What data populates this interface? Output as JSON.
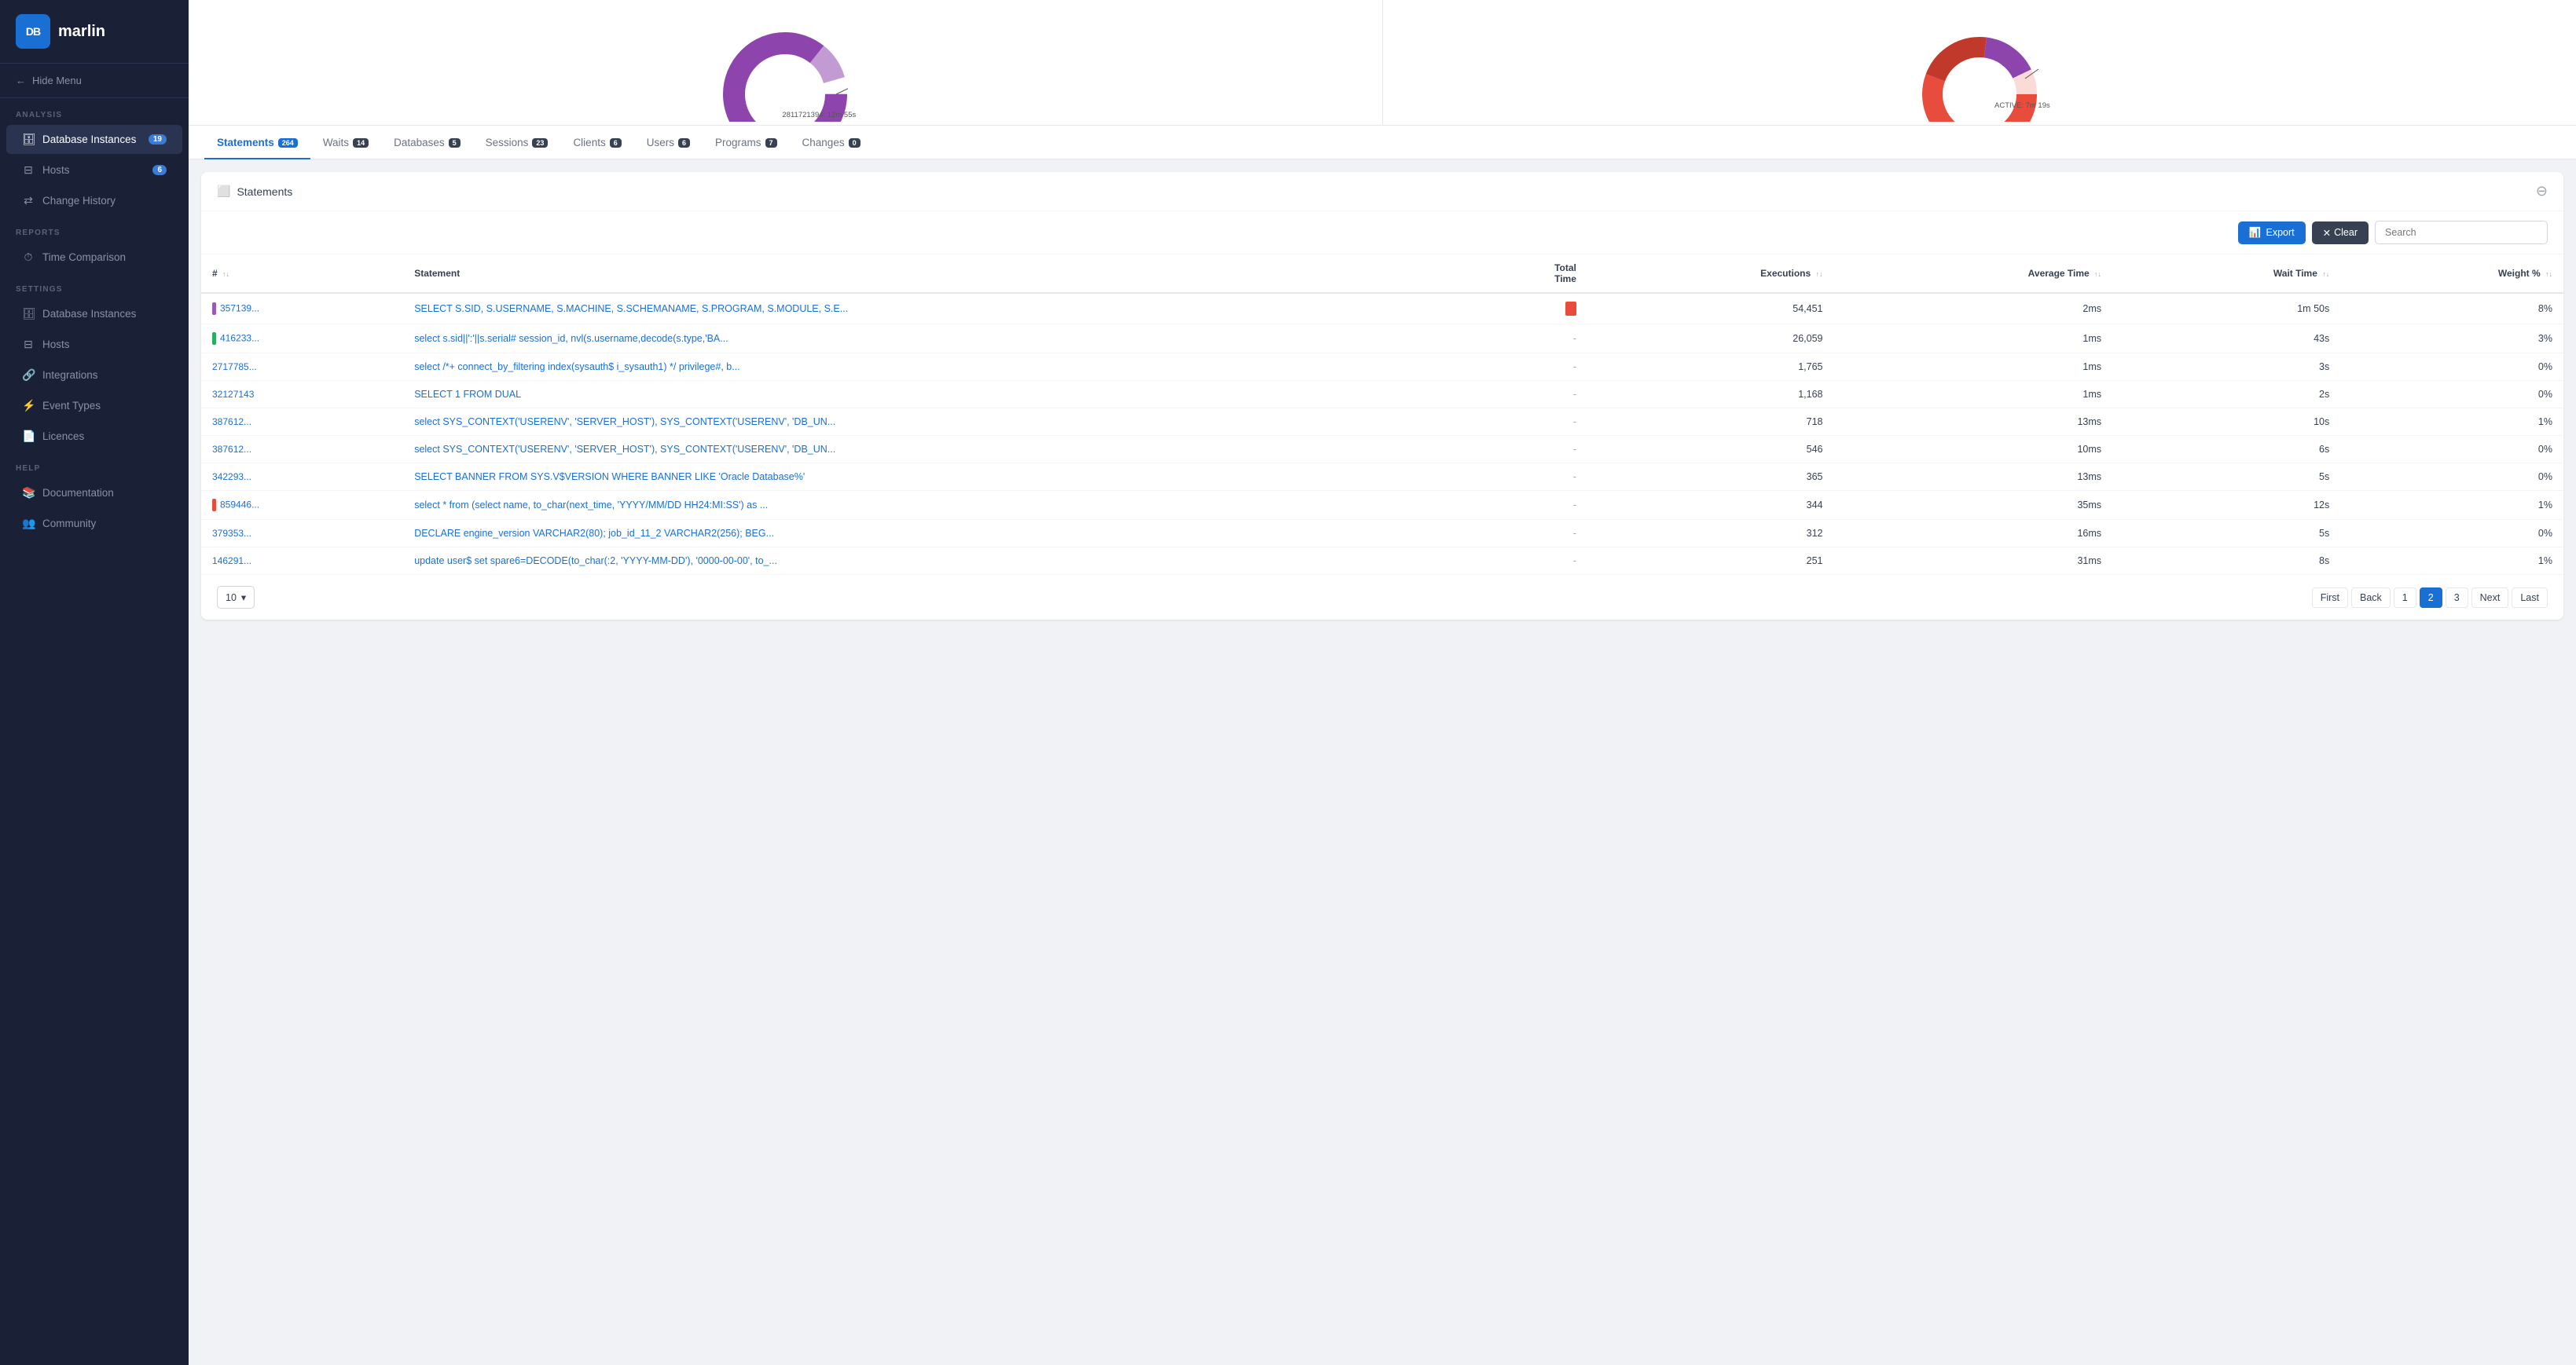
{
  "sidebar": {
    "logo": {
      "text": "DB marlin",
      "db": "DB"
    },
    "hide_menu": "Hide Menu",
    "sections": [
      {
        "label": "ANALYSIS",
        "items": [
          {
            "id": "db-instances",
            "label": "Database Instances",
            "badge": "19",
            "active": true,
            "icon": "🗄"
          },
          {
            "id": "hosts",
            "label": "Hosts",
            "badge": "6",
            "active": false,
            "icon": "⊟"
          },
          {
            "id": "change-history",
            "label": "Change History",
            "badge": null,
            "active": false,
            "icon": "⇄"
          }
        ]
      },
      {
        "label": "REPORTS",
        "items": [
          {
            "id": "time-comparison",
            "label": "Time Comparison",
            "badge": null,
            "active": false,
            "icon": "⏱"
          }
        ]
      },
      {
        "label": "SETTINGS",
        "items": [
          {
            "id": "settings-db",
            "label": "Database Instances",
            "badge": null,
            "active": false,
            "icon": "🗄"
          },
          {
            "id": "settings-hosts",
            "label": "Hosts",
            "badge": null,
            "active": false,
            "icon": "⊟"
          },
          {
            "id": "settings-integrations",
            "label": "Integrations",
            "badge": null,
            "active": false,
            "icon": "🔗"
          },
          {
            "id": "settings-events",
            "label": "Event Types",
            "badge": null,
            "active": false,
            "icon": "⚡"
          },
          {
            "id": "settings-licences",
            "label": "Licences",
            "badge": null,
            "active": false,
            "icon": "📄"
          }
        ]
      },
      {
        "label": "HELP",
        "items": [
          {
            "id": "help-docs",
            "label": "Documentation",
            "badge": null,
            "active": false,
            "icon": "📚"
          },
          {
            "id": "help-community",
            "label": "Community",
            "badge": null,
            "active": false,
            "icon": "👥"
          }
        ]
      }
    ]
  },
  "tabs": [
    {
      "id": "statements",
      "label": "Statements",
      "badge": "264",
      "active": true
    },
    {
      "id": "waits",
      "label": "Waits",
      "badge": "14",
      "active": false
    },
    {
      "id": "databases",
      "label": "Databases",
      "badge": "5",
      "active": false
    },
    {
      "id": "sessions",
      "label": "Sessions",
      "badge": "23",
      "active": false
    },
    {
      "id": "clients",
      "label": "Clients",
      "badge": "6",
      "active": false
    },
    {
      "id": "users",
      "label": "Users",
      "badge": "6",
      "active": false
    },
    {
      "id": "programs",
      "label": "Programs",
      "badge": "7",
      "active": false
    },
    {
      "id": "changes",
      "label": "Changes",
      "badge": "0",
      "active": false
    }
  ],
  "table": {
    "title": "Statements",
    "export_label": "Export",
    "clear_label": "Clear",
    "search_placeholder": "Search",
    "columns": [
      "#",
      "Statement",
      "Total Time",
      "Executions",
      "Average Time",
      "Wait Time",
      "Weight %"
    ],
    "rows": [
      {
        "id": "3571393",
        "id_display": "357139...",
        "color": "#9b59b6",
        "statement": "SELECT S.SID, S.USERNAME, S.MACHINE, S.SCHEMANAME, S.PROGRAM, S.MODULE, S.E...",
        "total_time_bar": true,
        "executions": "54,451",
        "avg_time": "2ms",
        "wait_time": "1m 50s",
        "weight": "8%",
        "dash": false
      },
      {
        "id": "4162333",
        "id_display": "416233...",
        "color": "#27ae60",
        "statement": "select s.sid||':'||s.serial# session_id, nvl(s.username,decode(s.type,'BA...",
        "total_time_bar": false,
        "executions": "26,059",
        "avg_time": "1ms",
        "wait_time": "43s",
        "weight": "3%",
        "dash": true
      },
      {
        "id": "2717785",
        "id_display": "2717785...",
        "color": null,
        "statement": "select /*+ connect_by_filtering index(sysauth$ i_sysauth1) */ privilege#, b...",
        "total_time_bar": false,
        "executions": "1,765",
        "avg_time": "1ms",
        "wait_time": "3s",
        "weight": "0%",
        "dash": true
      },
      {
        "id": "32127143",
        "id_display": "32127143",
        "color": null,
        "statement": "SELECT 1 FROM DUAL",
        "total_time_bar": false,
        "executions": "1,168",
        "avg_time": "1ms",
        "wait_time": "2s",
        "weight": "0%",
        "dash": true
      },
      {
        "id": "3876120",
        "id_display": "387612...",
        "color": null,
        "statement": "select SYS_CONTEXT('USERENV', 'SERVER_HOST'), SYS_CONTEXT('USERENV', 'DB_UN...",
        "total_time_bar": false,
        "executions": "718",
        "avg_time": "13ms",
        "wait_time": "10s",
        "weight": "1%",
        "dash": true
      },
      {
        "id": "3876121",
        "id_display": "387612...",
        "color": null,
        "statement": "select SYS_CONTEXT('USERENV', 'SERVER_HOST'), SYS_CONTEXT('USERENV', 'DB_UN...",
        "total_time_bar": false,
        "executions": "546",
        "avg_time": "10ms",
        "wait_time": "6s",
        "weight": "0%",
        "dash": true
      },
      {
        "id": "3422930",
        "id_display": "342293...",
        "color": null,
        "statement": "SELECT BANNER FROM SYS.V$VERSION WHERE BANNER LIKE 'Oracle Database%'",
        "total_time_bar": false,
        "executions": "365",
        "avg_time": "13ms",
        "wait_time": "5s",
        "weight": "0%",
        "dash": true
      },
      {
        "id": "8594460",
        "id_display": "859446...",
        "color": "#e74c3c",
        "statement": "select * from (select name, to_char(next_time, 'YYYY/MM/DD HH24:MI:SS') as ...",
        "total_time_bar": false,
        "executions": "344",
        "avg_time": "35ms",
        "wait_time": "12s",
        "weight": "1%",
        "dash": true
      },
      {
        "id": "3793530",
        "id_display": "379353...",
        "color": null,
        "statement": "DECLARE engine_version VARCHAR2(80); job_id_11_2 VARCHAR2(256); BEG...",
        "total_time_bar": false,
        "executions": "312",
        "avg_time": "16ms",
        "wait_time": "5s",
        "weight": "0%",
        "dash": true
      },
      {
        "id": "1462910",
        "id_display": "146291...",
        "color": null,
        "statement": "update user$ set spare6=DECODE(to_char(:2, 'YYYY-MM-DD'), '0000-00-00', to_...",
        "total_time_bar": false,
        "executions": "251",
        "avg_time": "31ms",
        "wait_time": "8s",
        "weight": "1%",
        "dash": true
      }
    ],
    "pagination": {
      "per_page": "10",
      "pages": [
        "First",
        "Back",
        "1",
        "2",
        "3",
        "Next",
        "Last"
      ],
      "active_page": "2"
    }
  },
  "charts": {
    "left": {
      "label": "2811721394: 12m 55s"
    },
    "right": {
      "label": "ACTIVE: 7m 19s"
    }
  }
}
